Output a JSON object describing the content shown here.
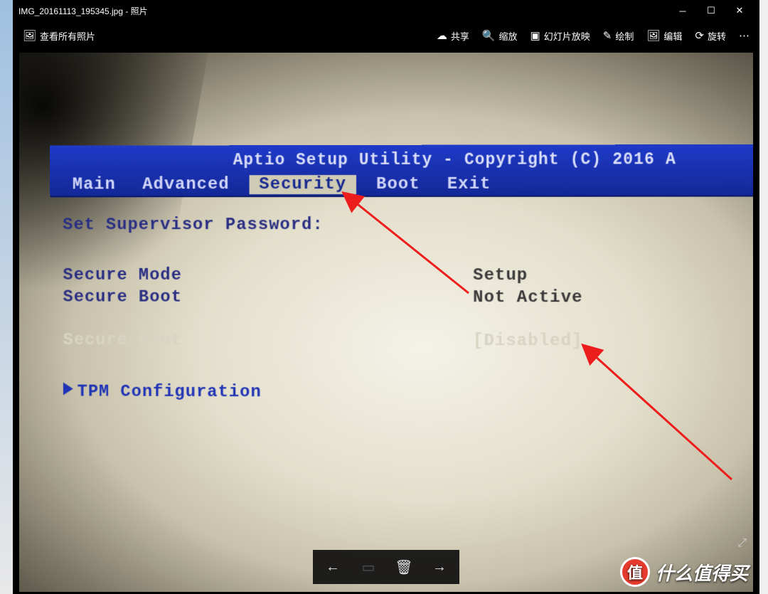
{
  "window": {
    "title": "IMG_20161113_195345.jpg - 照片",
    "view_all_label": "查看所有照片"
  },
  "toolbar": {
    "share": "共享",
    "zoom": "缩放",
    "slideshow": "幻灯片放映",
    "draw": "绘制",
    "edit": "编辑",
    "rotate": "旋转"
  },
  "bios": {
    "title": "Aptio Setup Utility - Copyright (C) 2016 A",
    "tabs": {
      "main": "Main",
      "advanced": "Advanced",
      "security": "Security",
      "boot": "Boot",
      "exit": "Exit"
    },
    "active_tab": "security",
    "rows": {
      "supervisor": {
        "label": "Set Supervisor Password:",
        "value": ""
      },
      "secure_mode": {
        "label": "Secure Mode",
        "value": "Setup"
      },
      "secure_boot_status": {
        "label": "Secure Boot",
        "value": "Not Active"
      },
      "secure_boot_option": {
        "label": "Secure Boot",
        "value": "[Disabled]"
      },
      "tpm": {
        "label": "TPM Configuration"
      }
    }
  },
  "watermark": {
    "badge": "值",
    "text": "什么值得买"
  }
}
